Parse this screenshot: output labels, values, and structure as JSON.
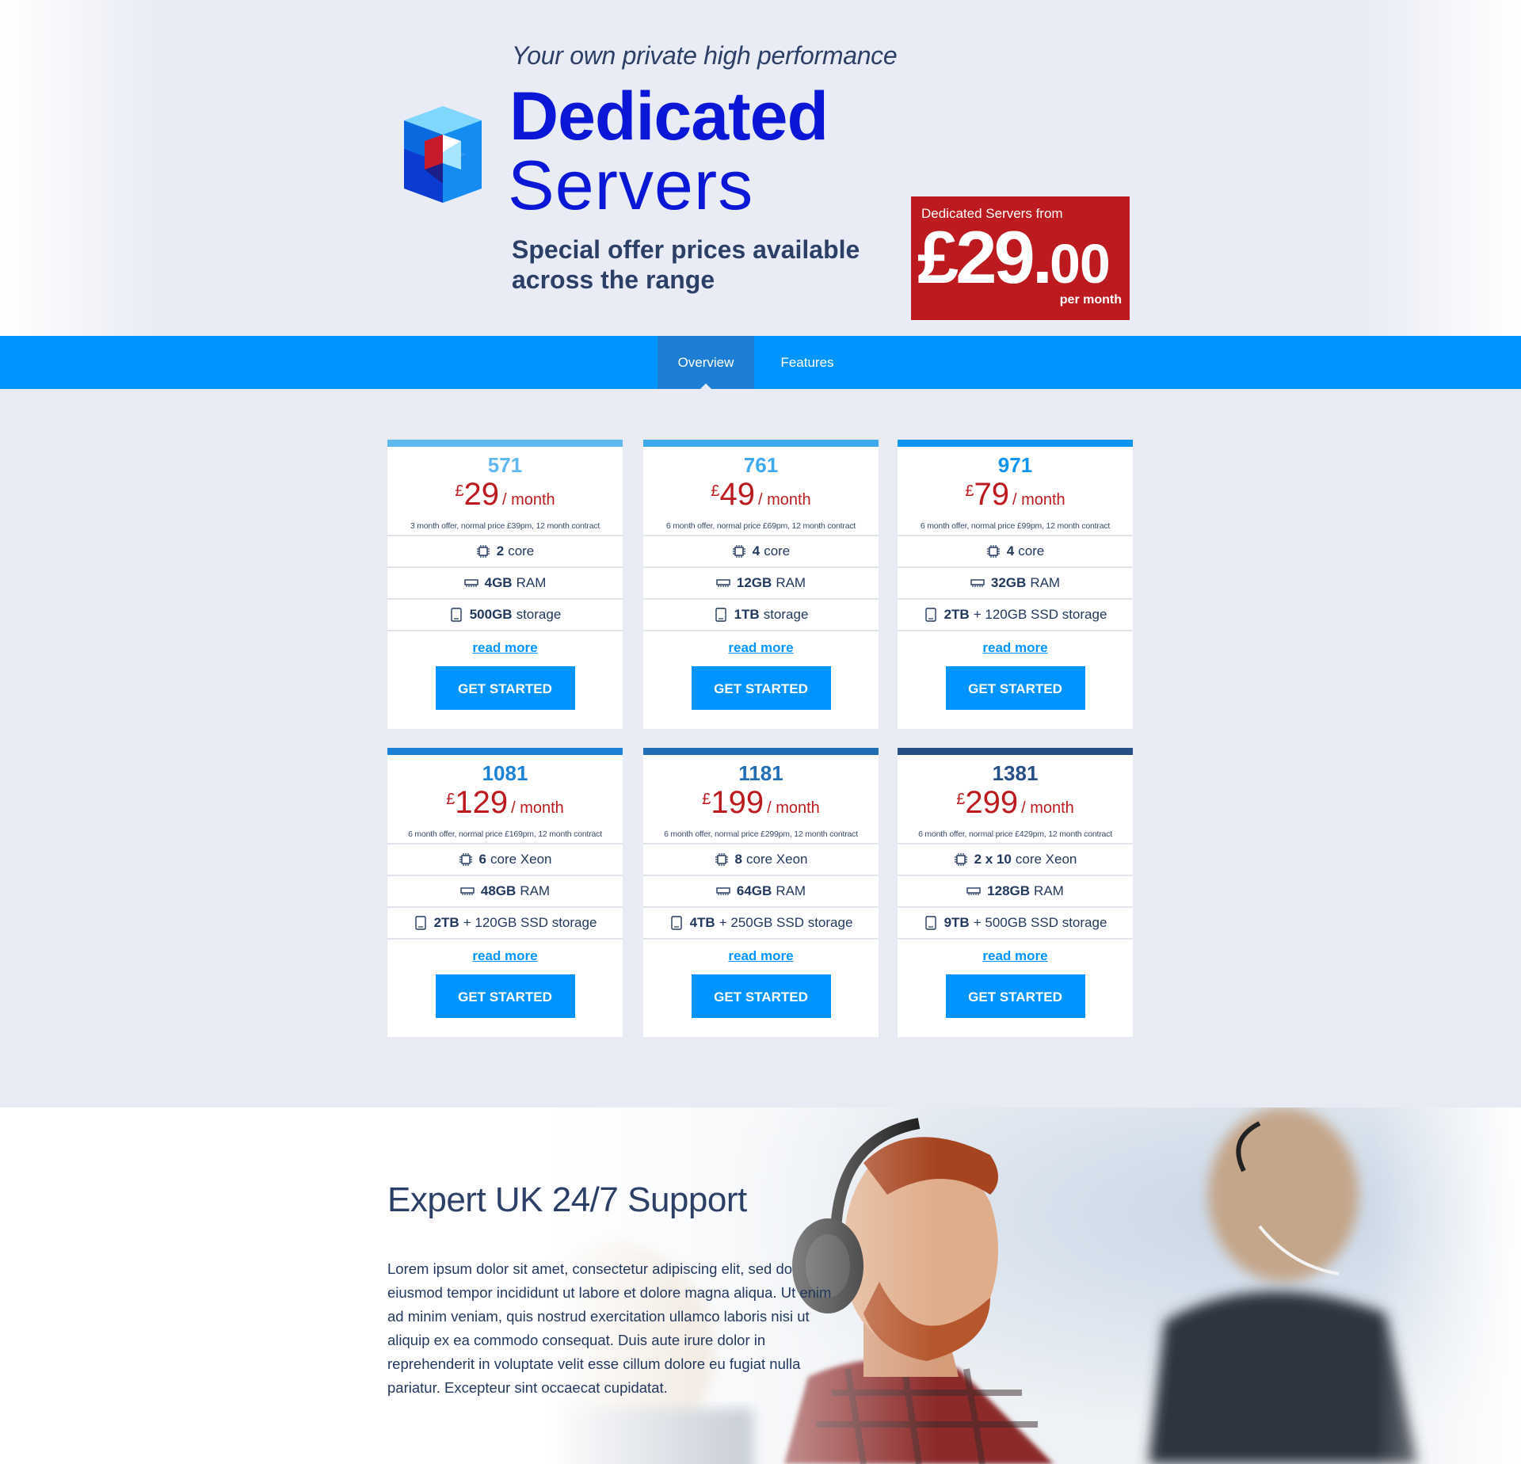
{
  "hero": {
    "tagline": "Your own private high performance",
    "title_line1": "Dedicated",
    "title_line2": "Servers",
    "subtitle_line1": "Special offer prices available",
    "subtitle_line2": "across the range",
    "promo": {
      "heading": "Dedicated Servers from",
      "price_main": "£29.",
      "price_cents": "00",
      "footer": "per month"
    }
  },
  "nav": {
    "tabs": [
      {
        "label": "Overview",
        "active": true
      },
      {
        "label": "Features",
        "active": false
      }
    ]
  },
  "plans": [
    {
      "name": "571",
      "currency": "£",
      "price": "29",
      "period": "/ month",
      "note": "3 month offer, normal price £39pm, 12 month contract",
      "accent": "#5fb8f2",
      "specs": [
        {
          "icon": "cpu-icon",
          "bold": "2",
          "text": "core"
        },
        {
          "icon": "ram-icon",
          "bold": "4GB",
          "text": "RAM"
        },
        {
          "icon": "storage-icon",
          "bold": "500GB",
          "text": "storage"
        }
      ],
      "read_more": "read more",
      "cta": "GET STARTED"
    },
    {
      "name": "761",
      "currency": "£",
      "price": "49",
      "period": "/ month",
      "note": "6 month offer, normal price £69pm, 12 month contract",
      "accent": "#3fa9ef",
      "specs": [
        {
          "icon": "cpu-icon",
          "bold": "4",
          "text": "core"
        },
        {
          "icon": "ram-icon",
          "bold": "12GB",
          "text": "RAM"
        },
        {
          "icon": "storage-icon",
          "bold": "1TB",
          "text": "storage"
        }
      ],
      "read_more": "read more",
      "cta": "GET STARTED"
    },
    {
      "name": "971",
      "currency": "£",
      "price": "79",
      "period": "/ month",
      "note": "6 month offer, normal price £99pm, 12 month contract",
      "accent": "#0d93f0",
      "specs": [
        {
          "icon": "cpu-icon",
          "bold": "4",
          "text": "core"
        },
        {
          "icon": "ram-icon",
          "bold": "32GB",
          "text": "RAM"
        },
        {
          "icon": "storage-icon",
          "bold": "2TB",
          "text": "+ 120GB SSD storage"
        }
      ],
      "read_more": "read more",
      "cta": "GET STARTED"
    },
    {
      "name": "1081",
      "currency": "£",
      "price": "129",
      "period": "/ month",
      "note": "6 month offer, normal price £169pm, 12 month contract",
      "accent": "#1c82d6",
      "specs": [
        {
          "icon": "cpu-icon",
          "bold": "6",
          "text": "core Xeon"
        },
        {
          "icon": "ram-icon",
          "bold": "48GB",
          "text": "RAM"
        },
        {
          "icon": "storage-icon",
          "bold": "2TB",
          "text": "+ 120GB SSD storage"
        }
      ],
      "read_more": "read more",
      "cta": "GET STARTED"
    },
    {
      "name": "1181",
      "currency": "£",
      "price": "199",
      "period": "/ month",
      "note": "6 month offer, normal price £299pm, 12 month contract",
      "accent": "#1f6eb6",
      "specs": [
        {
          "icon": "cpu-icon",
          "bold": "8",
          "text": "core Xeon"
        },
        {
          "icon": "ram-icon",
          "bold": "64GB",
          "text": "RAM"
        },
        {
          "icon": "storage-icon",
          "bold": "4TB",
          "text": "+ 250GB SSD storage"
        }
      ],
      "read_more": "read more",
      "cta": "GET STARTED"
    },
    {
      "name": "1381",
      "currency": "£",
      "price": "299",
      "period": "/ month",
      "note": "6 month offer, normal price £429pm, 12 month contract",
      "accent": "#264f86",
      "specs": [
        {
          "icon": "cpu-icon",
          "bold": "2 x 10",
          "text": "core Xeon"
        },
        {
          "icon": "ram-icon",
          "bold": "128GB",
          "text": "RAM"
        },
        {
          "icon": "storage-icon",
          "bold": "9TB",
          "text": "+ 500GB SSD storage"
        }
      ],
      "read_more": "read more",
      "cta": "GET STARTED"
    }
  ],
  "support": {
    "title": "Expert UK 24/7 Support",
    "body": "Lorem ipsum dolor sit amet, consectetur adipiscing elit, sed do eiusmod tempor incididunt ut labore et dolore magna aliqua. Ut enim ad minim veniam, quis nostrud exercitation ullamco laboris nisi ut aliquip ex ea commodo consequat. Duis aute irure dolor in reprehenderit in voluptate velit esse cillum dolore eu fugiat nulla pariatur. Excepteur sint occaecat cupidatat.",
    "image": "support-staff-photo"
  },
  "colors": {
    "brand_blue": "#0094ff",
    "title_blue": "#0a17d6",
    "price_red": "#bd1a1f",
    "text_navy": "#22395d",
    "background": "#e8ebf4"
  }
}
